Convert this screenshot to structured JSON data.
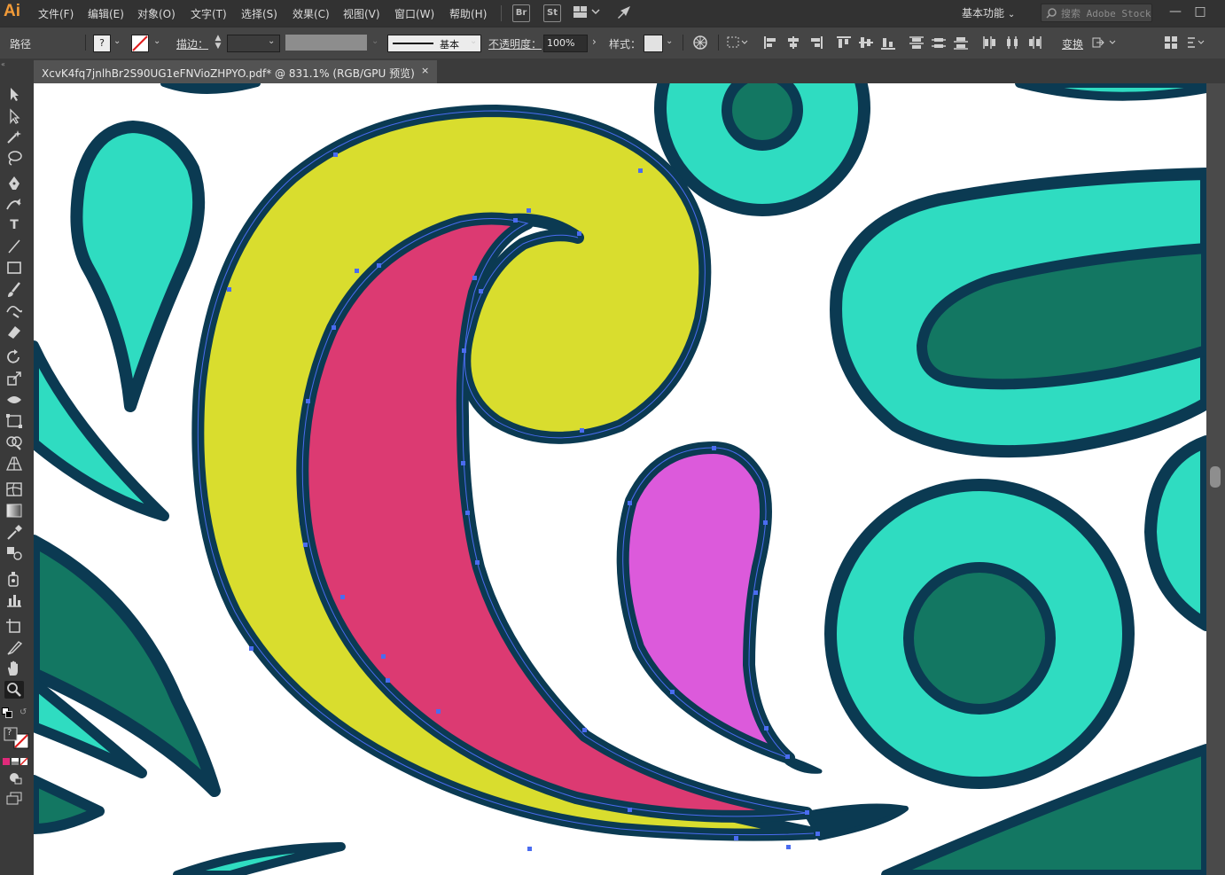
{
  "app": {
    "logo": "Ai"
  },
  "menu": [
    "文件(F)",
    "编辑(E)",
    "对象(O)",
    "文字(T)",
    "选择(S)",
    "效果(C)",
    "视图(V)",
    "窗口(W)",
    "帮助(H)"
  ],
  "app_buttons": [
    "Br",
    "St"
  ],
  "workspace": "基本功能",
  "search": {
    "placeholder": "搜索 Adobe Stock"
  },
  "control": {
    "selection_label": "路径",
    "fill_value": "?",
    "stroke_label": "描边：",
    "brush_label": "基本",
    "opacity_label": "不透明度：",
    "opacity_value": "100%",
    "style_label": "样式：",
    "transform_label": "变换"
  },
  "document_tab": {
    "title": "XcvK4fq7jnlhBr2S90UG1eFNVioZHPYO.pdf*  @  831.1%  (RGB/GPU 预览)",
    "close": "×"
  },
  "tools": [
    "selection-tool",
    "direct-selection-tool",
    "magic-wand-tool",
    "lasso-tool",
    "pen-tool",
    "curvature-tool",
    "type-tool",
    "line-tool",
    "rectangle-tool",
    "paintbrush-tool",
    "shaper-tool",
    "eraser-tool",
    "rotate-tool",
    "scale-tool",
    "width-tool",
    "free-transform-tool",
    "shape-builder-tool",
    "perspective-grid-tool",
    "mesh-tool",
    "gradient-tool",
    "eyedropper-tool",
    "blend-tool",
    "symbol-sprayer-tool",
    "column-graph-tool",
    "artboard-tool",
    "slice-tool",
    "hand-tool",
    "zoom-tool"
  ],
  "toolbar_swatch": "?",
  "colors": {
    "outline": "#0b3a52",
    "yellow": "#d9dd2e",
    "crimson": "#dc3a72",
    "magenta": "#dc5adb",
    "teal_light": "#2fdcc1",
    "teal_dark": "#137762",
    "selection": "#4a6cf0"
  }
}
